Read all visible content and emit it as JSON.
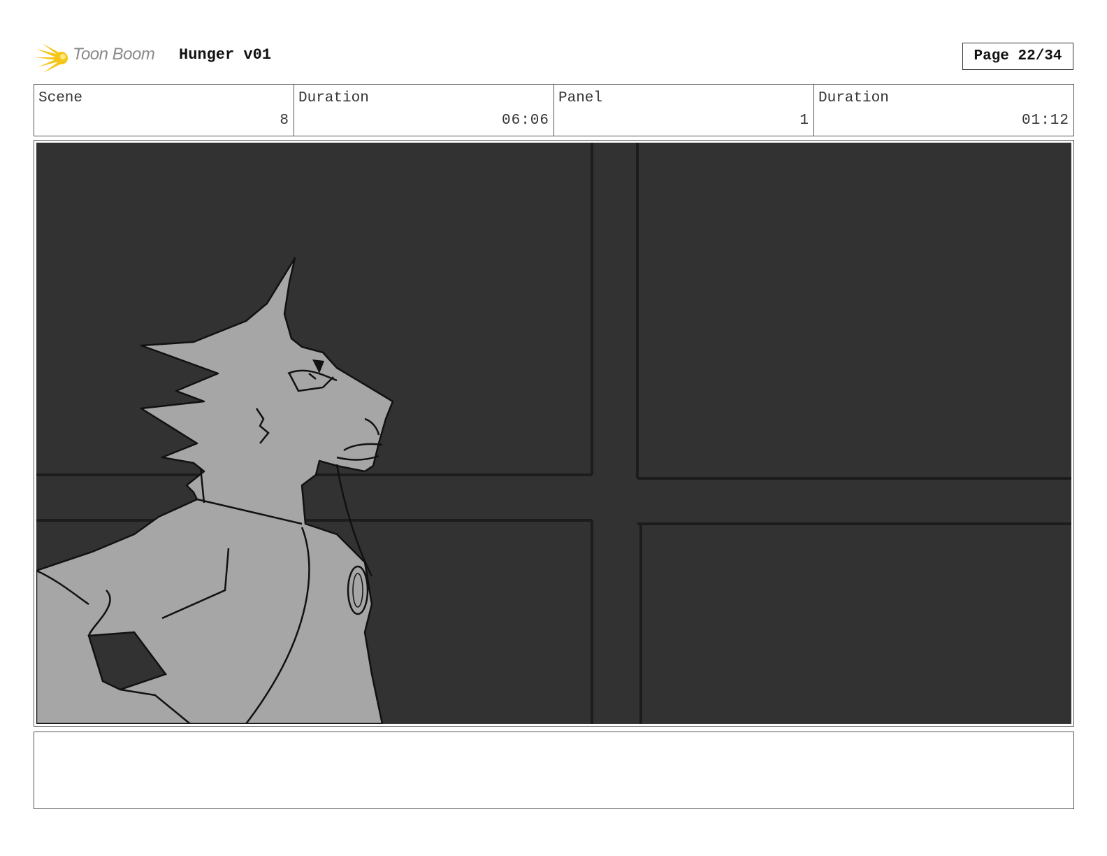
{
  "header": {
    "logo_text": "Toon Boom",
    "project_title": "Hunger v01",
    "page_label": "Page 22/34",
    "logo_color": "#f5c518"
  },
  "info": {
    "scene_label": "Scene",
    "scene_value": "8",
    "scene_duration_label": "Duration",
    "scene_duration_value": "06:06",
    "panel_label": "Panel",
    "panel_value": "1",
    "panel_duration_label": "Duration",
    "panel_duration_value": "01:12"
  },
  "panel": {
    "background_color": "#323232",
    "figure_color": "#a6a6a6"
  },
  "notes": {
    "text": ""
  }
}
